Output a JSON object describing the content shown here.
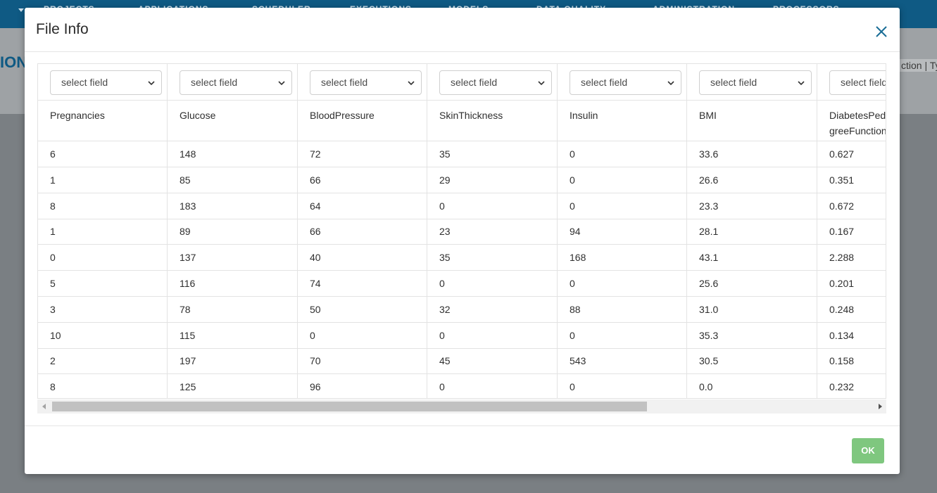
{
  "background": {
    "nav_items": [
      "PROJECTS",
      "APPLICATIONS",
      "SCHEDULER",
      "EXECUTIONS",
      "MODELS",
      "DATA QUALITY",
      "ADMINISTRATION",
      "PROCESSORS"
    ],
    "left_text": "ION",
    "right_text": "ction | Ty"
  },
  "modal": {
    "title": "File Info",
    "ok_label": "OK",
    "select_placeholder": "select field",
    "columns": [
      "Pregnancies",
      "Glucose",
      "BloodPressure",
      "SkinThickness",
      "Insulin",
      "BMI",
      "DiabetesPedigreeFunction"
    ],
    "rows": [
      [
        "6",
        "148",
        "72",
        "35",
        "0",
        "33.6",
        "0.627"
      ],
      [
        "1",
        "85",
        "66",
        "29",
        "0",
        "26.6",
        "0.351"
      ],
      [
        "8",
        "183",
        "64",
        "0",
        "0",
        "23.3",
        "0.672"
      ],
      [
        "1",
        "89",
        "66",
        "23",
        "94",
        "28.1",
        "0.167"
      ],
      [
        "0",
        "137",
        "40",
        "35",
        "168",
        "43.1",
        "2.288"
      ],
      [
        "5",
        "116",
        "74",
        "0",
        "0",
        "25.6",
        "0.201"
      ],
      [
        "3",
        "78",
        "50",
        "32",
        "88",
        "31.0",
        "0.248"
      ],
      [
        "10",
        "115",
        "0",
        "0",
        "0",
        "35.3",
        "0.134"
      ],
      [
        "2",
        "197",
        "70",
        "45",
        "543",
        "30.5",
        "0.158"
      ],
      [
        "8",
        "125",
        "96",
        "0",
        "0",
        "0.0",
        "0.232"
      ]
    ]
  },
  "colors": {
    "nav_bg": "#0f5a84",
    "ok_button": "#7fc77f",
    "close_icon": "#1a6d96"
  }
}
